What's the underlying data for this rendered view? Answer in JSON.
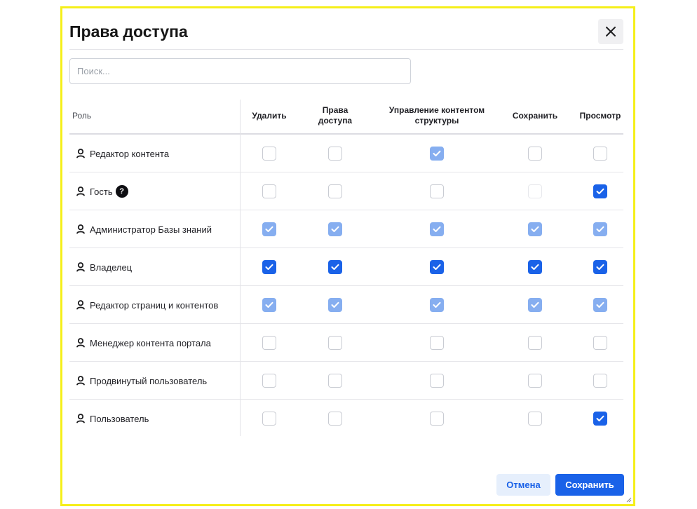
{
  "dialog": {
    "title": "Права доступа",
    "close_icon": "close-icon"
  },
  "search": {
    "placeholder": "Поиск...",
    "value": ""
  },
  "table": {
    "role_header": "Роль",
    "columns": [
      {
        "key": "delete",
        "label": "Удалить"
      },
      {
        "key": "access",
        "label": "Права доступа"
      },
      {
        "key": "manage",
        "label": "Управление контентом структуры"
      },
      {
        "key": "save",
        "label": "Сохранить"
      },
      {
        "key": "view",
        "label": "Просмотр"
      }
    ],
    "rows": [
      {
        "role": "Редактор контента",
        "help": false,
        "perms": [
          "unchecked",
          "unchecked",
          "checked-light",
          "unchecked",
          "unchecked"
        ]
      },
      {
        "role": "Гость",
        "help": true,
        "perms": [
          "unchecked",
          "unchecked",
          "unchecked",
          "disabled",
          "checked"
        ]
      },
      {
        "role": "Администратор Базы знаний",
        "help": false,
        "perms": [
          "checked-light",
          "checked-light",
          "checked-light",
          "checked-light",
          "checked-light"
        ]
      },
      {
        "role": "Владелец",
        "help": false,
        "perms": [
          "checked",
          "checked",
          "checked",
          "checked",
          "checked"
        ]
      },
      {
        "role": "Редактор страниц и контентов",
        "help": false,
        "perms": [
          "checked-light",
          "checked-light",
          "checked-light",
          "checked-light",
          "checked-light"
        ]
      },
      {
        "role": "Менеджер контента портала",
        "help": false,
        "perms": [
          "unchecked",
          "unchecked",
          "unchecked",
          "unchecked",
          "unchecked"
        ]
      },
      {
        "role": "Продвинутый пользователь",
        "help": false,
        "perms": [
          "unchecked",
          "unchecked",
          "unchecked",
          "unchecked",
          "unchecked"
        ]
      },
      {
        "role": "Пользователь",
        "help": false,
        "perms": [
          "unchecked",
          "unchecked",
          "unchecked",
          "unchecked",
          "checked"
        ]
      }
    ]
  },
  "footer": {
    "cancel_label": "Отмена",
    "save_label": "Сохранить"
  },
  "colors": {
    "accent": "#1a62e8",
    "accent_light": "#86aef0",
    "frame": "#f5ef1a"
  }
}
